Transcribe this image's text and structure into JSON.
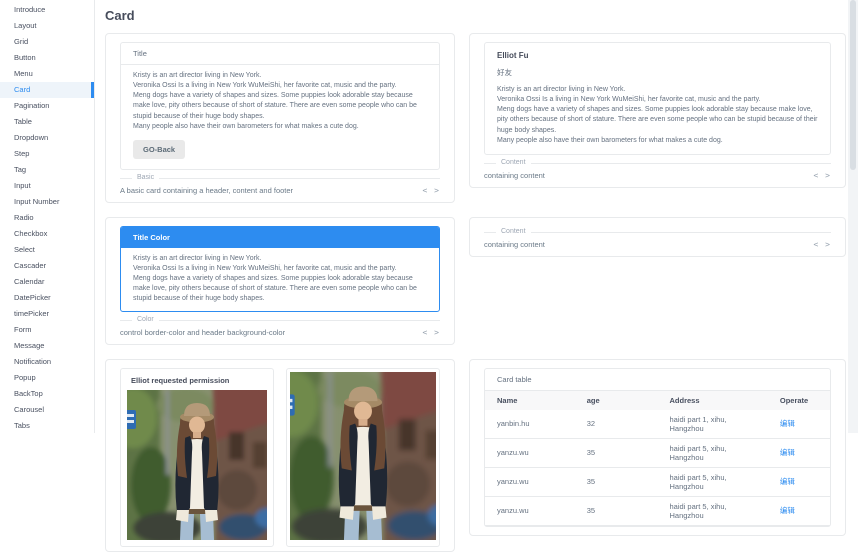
{
  "colors": {
    "accent": "#2d8cf0",
    "color_card_header_bg": "#2d8cf0",
    "edit_link": "#2d8cf0"
  },
  "ui": {
    "code_toggle": "< >"
  },
  "page": {
    "title": "Card"
  },
  "sidebar": {
    "items": [
      {
        "label": "Introduce"
      },
      {
        "label": "Layout"
      },
      {
        "label": "Grid"
      },
      {
        "label": "Button"
      },
      {
        "label": "Menu"
      },
      {
        "label": "Card",
        "active": true
      },
      {
        "label": "Pagination"
      },
      {
        "label": "Table"
      },
      {
        "label": "Dropdown"
      },
      {
        "label": "Step"
      },
      {
        "label": "Tag"
      },
      {
        "label": "Input"
      },
      {
        "label": "Input Number"
      },
      {
        "label": "Radio"
      },
      {
        "label": "Checkbox"
      },
      {
        "label": "Select"
      },
      {
        "label": "Cascader"
      },
      {
        "label": "Calendar"
      },
      {
        "label": "DatePicker"
      },
      {
        "label": "timePicker"
      },
      {
        "label": "Form"
      },
      {
        "label": "Message"
      },
      {
        "label": "Notification"
      },
      {
        "label": "Popup"
      },
      {
        "label": "BackTop"
      },
      {
        "label": "Carousel"
      },
      {
        "label": "Tabs"
      }
    ]
  },
  "panels": {
    "basic": {
      "card_title": "Title",
      "paragraphs": [
        "Kristy is an art director living in New York.",
        "Veronika Ossi Is a living in New York WuMeiShi, her favorite cat, music and the party.",
        "Meng dogs have a variety of shapes and sizes. Some puppies look adorable stay because make love, pity others because of short of stature. There are even some people who can be stupid because of their huge body shapes.",
        "Many people also have their own barometers for what makes a cute dog."
      ],
      "button_label": "GO-Back",
      "section_label": "Basic",
      "description": "A basic card containing a header, content and footer"
    },
    "content_demo": {
      "card_title": "Elliot Fu",
      "subtitle": "好友",
      "paragraphs": [
        "Kristy is an art director living in New York.",
        "Veronika Ossi Is a living in New York WuMeiShi, her favorite cat, music and the party.",
        "Meng dogs have a variety of shapes and sizes. Some puppies look adorable stay because make love, pity others because of short of stature. There are even some people who can be stupid because of their huge body shapes.",
        "Many people also have their own barometers for what makes a cute dog."
      ],
      "section_label": "Content",
      "description": "containing content"
    },
    "color": {
      "card_title": "Title Color",
      "paragraphs": [
        "Kristy is an art director living in New York.",
        "Veronika Ossi Is a living in New York WuMeiShi, her favorite cat, music and the party.",
        "Meng dogs have a variety of shapes and sizes. Some puppies look adorable stay because make love, pity others because of short of stature. There are even some people who can be stupid because of their huge body shapes."
      ],
      "section_label": "Color",
      "description": "control border-color and header background-color"
    },
    "content_small": {
      "section_label": "Content",
      "description": "containing content"
    },
    "image_demo": {
      "card_title": "Elliot requested permission"
    },
    "table_demo": {
      "card_title": "Card table",
      "columns": [
        "Name",
        "age",
        "Address",
        "Operate"
      ],
      "rows": [
        {
          "name": "yanbin.hu",
          "age": "32",
          "address": "haidi part 1, xihu, Hangzhou",
          "operate": "编辑"
        },
        {
          "name": "yanzu.wu",
          "age": "35",
          "address": "haidi part 5, xihu, Hangzhou",
          "operate": "编辑"
        },
        {
          "name": "yanzu.wu",
          "age": "35",
          "address": "haidi part 5, xihu, Hangzhou",
          "operate": "编辑"
        },
        {
          "name": "yanzu.wu",
          "age": "35",
          "address": "haidi part 5, xihu, Hangzhou",
          "operate": "编辑"
        }
      ]
    }
  }
}
